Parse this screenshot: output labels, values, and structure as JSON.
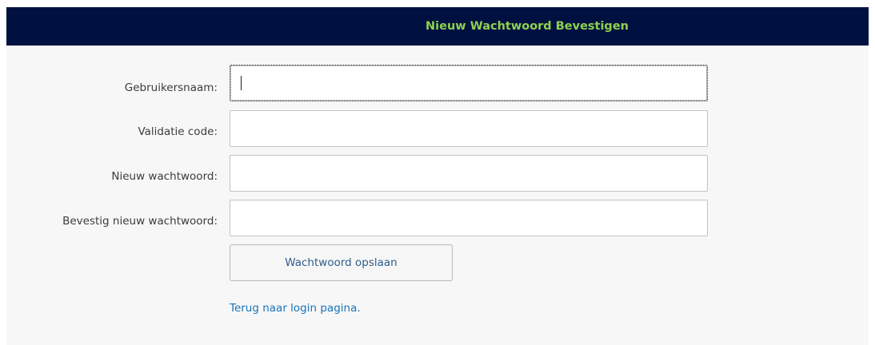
{
  "header": {
    "title": "Nieuw Wachtwoord Bevestigen"
  },
  "form": {
    "username_label": "Gebruikersnaam:",
    "username_value": "",
    "validation_label": "Validatie code:",
    "validation_value": "",
    "new_password_label": "Nieuw wachtwoord:",
    "new_password_value": "",
    "confirm_password_label": "Bevestig nieuw wachtwoord:",
    "confirm_password_value": "",
    "save_button_label": "Wachtwoord opslaan",
    "back_link_label": "Terug naar login pagina."
  },
  "colors": {
    "header_background": "#001141",
    "header_text": "#8fd14f",
    "link": "#1a74b8",
    "button_text": "#2e5d8c"
  }
}
